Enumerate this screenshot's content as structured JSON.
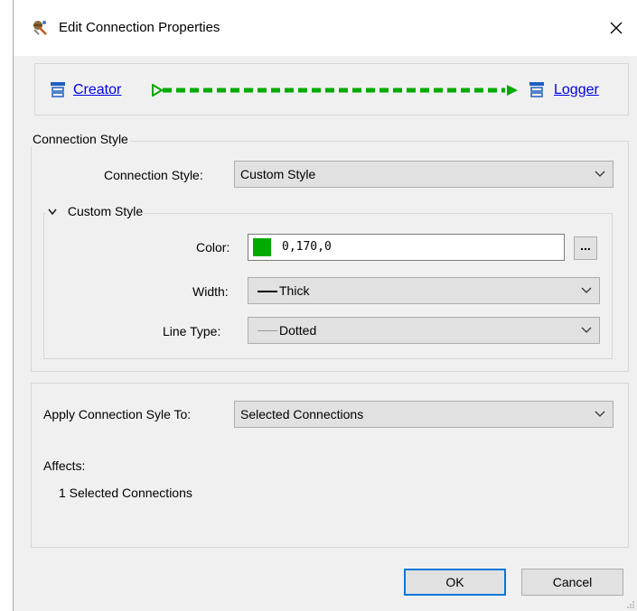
{
  "window": {
    "title": "Edit Connection Properties",
    "icon": "fme-wizard-icon",
    "close_icon": "close-icon"
  },
  "connection": {
    "source": "Creator",
    "target": "Logger",
    "line_color": "#00aa00",
    "node_icon": "transformer-icon"
  },
  "style_group": {
    "title": "Connection Style",
    "style_label": "Connection Style:",
    "style_value": "Custom Style",
    "custom": {
      "title": "Custom Style",
      "color_label": "Color:",
      "color_value": "0,170,0",
      "color_hex": "#00aa00",
      "browse_label": "...",
      "width_label": "Width:",
      "width_value": "Thick",
      "linetype_label": "Line Type:",
      "linetype_value": "Dotted"
    }
  },
  "apply_group": {
    "apply_label": "Apply Connection Syle To:",
    "apply_value": "Selected Connections",
    "affects_label": "Affects:",
    "affects_value": "1 Selected Connections"
  },
  "buttons": {
    "ok": "OK",
    "cancel": "Cancel"
  }
}
